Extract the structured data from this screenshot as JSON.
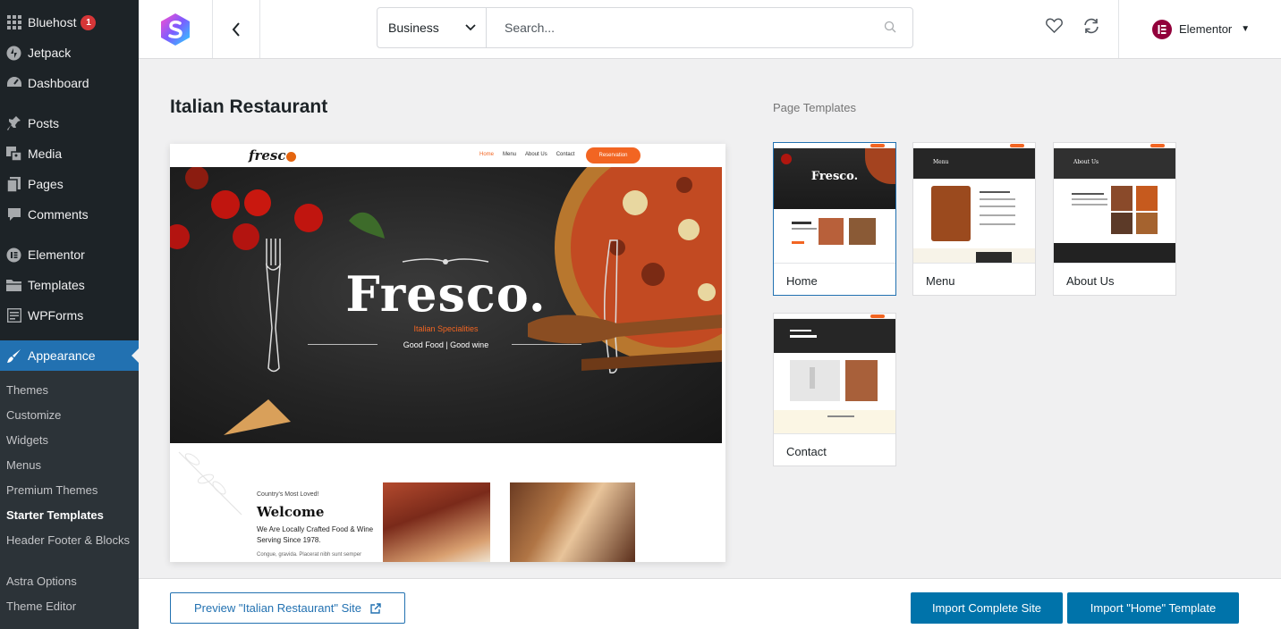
{
  "sidebar": {
    "items": [
      {
        "label": "Bluehost",
        "icon": "grid-icon",
        "badge": "1"
      },
      {
        "label": "Jetpack",
        "icon": "jetpack-icon"
      },
      {
        "label": "Dashboard",
        "icon": "dashboard-icon"
      },
      {
        "label": "Posts",
        "icon": "pin-icon"
      },
      {
        "label": "Media",
        "icon": "media-icon"
      },
      {
        "label": "Pages",
        "icon": "pages-icon"
      },
      {
        "label": "Comments",
        "icon": "comment-icon"
      },
      {
        "label": "Elementor",
        "icon": "elementor-icon"
      },
      {
        "label": "Templates",
        "icon": "folder-icon"
      },
      {
        "label": "WPForms",
        "icon": "forms-icon"
      },
      {
        "label": "Appearance",
        "icon": "brush-icon"
      }
    ],
    "submenu": [
      "Themes",
      "Customize",
      "Widgets",
      "Menus",
      "Premium Themes",
      "Starter Templates",
      "Header Footer & Blocks",
      "Astra Options",
      "Theme Editor"
    ],
    "current_submenu": "Starter Templates"
  },
  "topbar": {
    "category": "Business",
    "search_placeholder": "Search...",
    "builder": "Elementor"
  },
  "main": {
    "site_title": "Italian Restaurant",
    "preview": {
      "logo": "fresc",
      "nav_links": [
        "Home",
        "Menu",
        "About Us",
        "Contact"
      ],
      "cta": "Reservation",
      "brand": "Fresco.",
      "tagline": "Italian Specialities",
      "subtagline": "Good Food | Good wine",
      "kicker": "Country's Most Loved!",
      "welcome": "Welcome",
      "intro": "We Are Locally Crafted Food & Wine Serving Since 1978.",
      "small": "Congue, gravida. Placerat nibh sunt semper"
    }
  },
  "templates": {
    "heading": "Page Templates",
    "items": [
      {
        "label": "Home",
        "selected": true
      },
      {
        "label": "Menu",
        "selected": false
      },
      {
        "label": "About Us",
        "selected": false
      },
      {
        "label": "Contact",
        "selected": false
      }
    ]
  },
  "footer": {
    "preview_button": "Preview \"Italian Restaurant\" Site",
    "import_site": "Import Complete Site",
    "import_template": "Import \"Home\" Template"
  },
  "colors": {
    "accent": "#2271b1",
    "sidebar_bg": "#1d2327",
    "brand_orange": "#f26522"
  }
}
